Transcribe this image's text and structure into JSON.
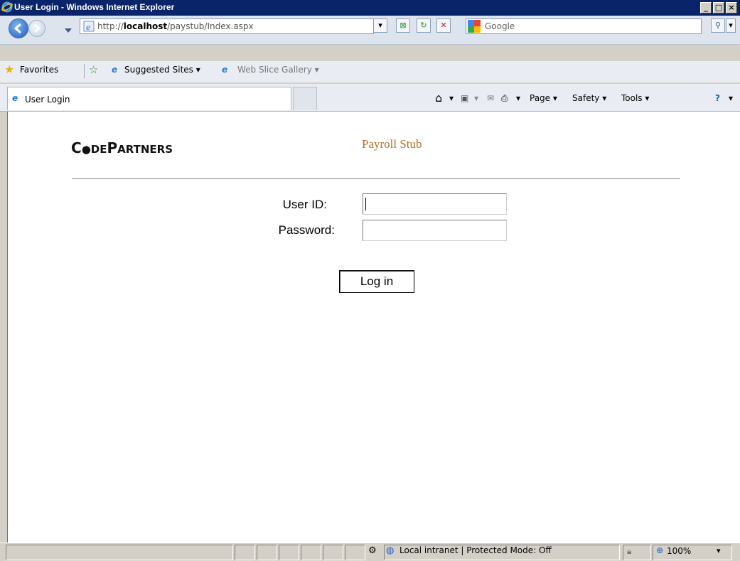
{
  "window": {
    "title": "User Login - Windows Internet Explorer",
    "min_label": "_",
    "max_label": "□",
    "close_label": "×"
  },
  "address": {
    "url_prefix": "http://",
    "url_host": "localhost",
    "url_path": "/paystub/Index.aspx",
    "search_placeholder": "Google"
  },
  "favorites": {
    "favorites_label": "Favorites",
    "suggested_sites": "Suggested Sites ▾",
    "web_slice": "Web Slice Gallery ▾"
  },
  "tab": {
    "label": "User Login"
  },
  "commandbar": {
    "page": "Page ▾",
    "safety": "Safety ▾",
    "tools": "Tools ▾"
  },
  "page": {
    "logo_parts": [
      "C",
      "●",
      "DE",
      "P",
      "ARTNERS"
    ],
    "app_title": "Payroll Stub",
    "user_id_label": "User ID:",
    "password_label": "Password:",
    "login_button": "Log in",
    "user_id_value": "",
    "password_value": ""
  },
  "status": {
    "zone_text": "Local intranet | Protected Mode: Off",
    "zoom": "100%"
  },
  "colors": {
    "title_bar": "#0a246a",
    "app_title": "#b66f25"
  }
}
